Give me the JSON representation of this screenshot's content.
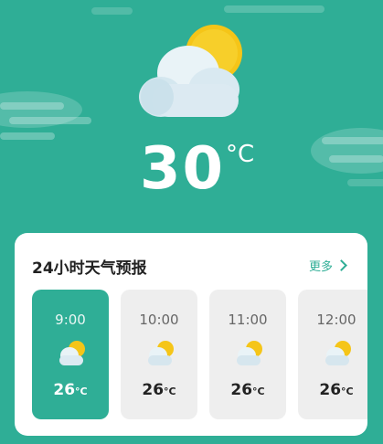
{
  "current": {
    "temperature": "30",
    "unit": "°C",
    "icon": "partly-cloudy-icon"
  },
  "forecast": {
    "title": "24小时天气预报",
    "more_label": "更多",
    "hours": [
      {
        "time": "9:00",
        "temp": "26",
        "unit": "°C",
        "icon": "partly-cloudy-icon",
        "active": true
      },
      {
        "time": "10:00",
        "temp": "26",
        "unit": "°C",
        "icon": "partly-cloudy-icon",
        "active": false
      },
      {
        "time": "11:00",
        "temp": "26",
        "unit": "°C",
        "icon": "partly-cloudy-icon",
        "active": false
      },
      {
        "time": "12:00",
        "temp": "26",
        "unit": "°C",
        "icon": "partly-cloudy-icon",
        "active": false
      }
    ]
  },
  "colors": {
    "accent": "#2fae96",
    "card": "#ffffff",
    "tile": "#eeeeee",
    "sun": "#f5c518"
  }
}
